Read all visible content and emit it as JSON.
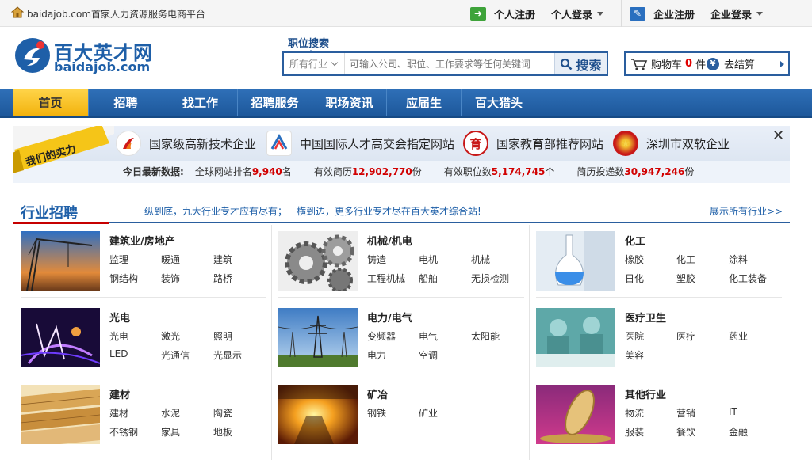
{
  "topbar": {
    "slogan": "baidajob.com首家人力资源服务电商平台",
    "personal_register": "个人注册",
    "personal_login": "个人登录",
    "company_register": "企业注册",
    "company_login": "企业登录"
  },
  "logo": {
    "cn": "百大英才网",
    "en": "baidajob.com"
  },
  "search": {
    "tab_label": "职位搜索",
    "industry_select": "所有行业",
    "placeholder": "可输入公司、职位、工作要求等任何关键词",
    "button_label": "搜索"
  },
  "cart": {
    "label": "购物车",
    "count": "0",
    "unit": "件",
    "checkout": "去结算"
  },
  "nav": {
    "items": [
      "首页",
      "招聘",
      "找工作",
      "招聘服务",
      "职场资讯",
      "应届生",
      "百大猎头"
    ]
  },
  "strength": {
    "ribbon": "我们的实力",
    "honors": [
      "国家级高新技术企业",
      "中国国际人才高交会指定网站",
      "国家教育部推荐网站",
      "深圳市双软企业"
    ],
    "stats_label": "今日最新数据:",
    "stats": [
      {
        "label": "全球网站排名",
        "value": "9,940",
        "unit": "名"
      },
      {
        "label": "有效简历",
        "value": "12,902,770",
        "unit": "份"
      },
      {
        "label": "有效职位数",
        "value": "5,174,745",
        "unit": "个"
      },
      {
        "label": "简历投递数",
        "value": "30,947,246",
        "unit": "份"
      }
    ]
  },
  "industry": {
    "title": "行业招聘",
    "slogan": "一纵到底，九大行业专才应有尽有；一横到边，更多行业专才尽在百大英才综合站!",
    "more": "展示所有行业>>",
    "categories": [
      {
        "name": "建筑业/房地产",
        "icon": "crane-image",
        "keywords": [
          "监理",
          "暖通",
          "建筑",
          "钢结构",
          "装饰",
          "路桥"
        ]
      },
      {
        "name": "机械/机电",
        "icon": "gears-image",
        "keywords": [
          "铸造",
          "电机",
          "机械",
          "工程机械",
          "船舶",
          "无损检测"
        ]
      },
      {
        "name": "化工",
        "icon": "flask-image",
        "keywords": [
          "橡胶",
          "化工",
          "涂料",
          "日化",
          "塑胶",
          "化工装备"
        ]
      },
      {
        "name": "光电",
        "icon": "light-image",
        "keywords": [
          "光电",
          "激光",
          "照明",
          "LED",
          "光通信",
          "光显示"
        ]
      },
      {
        "name": "电力/电气",
        "icon": "pylon-image",
        "keywords": [
          "变频器",
          "电气",
          "太阳能",
          "电力",
          "空调"
        ]
      },
      {
        "name": "医疗卫生",
        "icon": "surgery-image",
        "keywords": [
          "医院",
          "医疗",
          "药业",
          "美容"
        ]
      },
      {
        "name": "建材",
        "icon": "planks-image",
        "keywords": [
          "建材",
          "水泥",
          "陶瓷",
          "不锈钢",
          "家具",
          "地板"
        ]
      },
      {
        "name": "矿冶",
        "icon": "furnace-image",
        "keywords": [
          "钢铁",
          "矿业"
        ]
      },
      {
        "name": "其他行业",
        "icon": "coin-image",
        "keywords": [
          "物流",
          "营销",
          "IT",
          "服装",
          "餐饮",
          "金融"
        ]
      }
    ]
  }
}
